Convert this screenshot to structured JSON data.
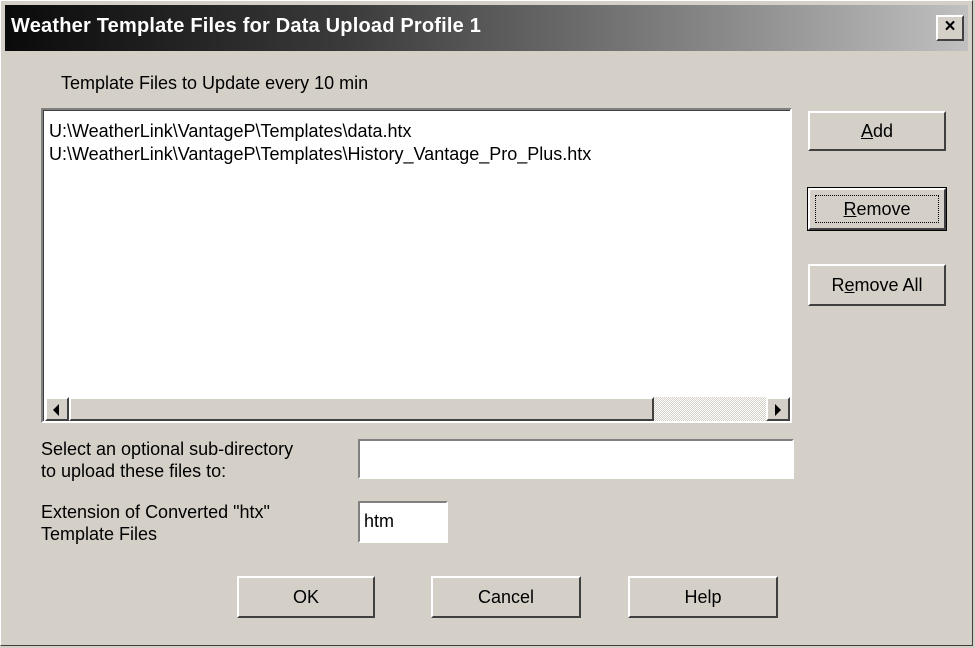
{
  "window": {
    "title": "Weather Template Files for Data Upload Profile 1",
    "close_label": "×"
  },
  "list_label": "Template Files to Update every 10 min",
  "files": [
    "U:\\WeatherLink\\VantageP\\Templates\\data.htx",
    "U:\\WeatherLink\\VantageP\\Templates\\History_Vantage_Pro_Plus.htx"
  ],
  "buttons": {
    "add_pre": "",
    "add_key": "A",
    "add_post": "dd",
    "remove_pre": "",
    "remove_key": "R",
    "remove_post": "emove",
    "remove_all_pre": "R",
    "remove_all_key": "e",
    "remove_all_post": "move All",
    "ok": "OK",
    "cancel": "Cancel",
    "help": "Help"
  },
  "subdir": {
    "label_line1": "Select an optional sub-directory",
    "label_line2": "to upload these files to:",
    "value": ""
  },
  "extension": {
    "label_line1": "Extension of Converted \"htx\"",
    "label_line2": "Template Files",
    "value": "htm"
  }
}
